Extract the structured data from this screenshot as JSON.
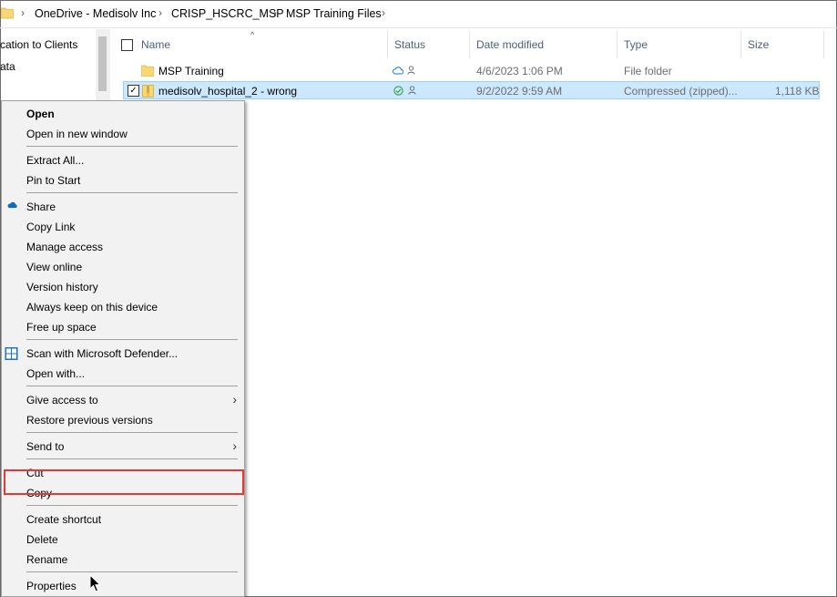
{
  "breadcrumb": [
    "OneDrive - Medisolv Inc",
    "CRISP_HSCRC_MSP",
    "MSP Training Files"
  ],
  "nav": {
    "items": [
      "cation to Clients",
      "ata"
    ]
  },
  "columns": {
    "name": "Name",
    "status": "Status",
    "date": "Date modified",
    "type": "Type",
    "size": "Size"
  },
  "files": [
    {
      "name": "MSP Training",
      "date": "4/6/2023 1:06 PM",
      "type": "File folder",
      "size": "",
      "status": "cloud"
    },
    {
      "name": "medisolv_hospital_2 - wrong",
      "date": "9/2/2022 9:59 AM",
      "type": "Compressed (zipped)...",
      "size": "1,118 KB",
      "status": "synced",
      "selected": true
    }
  ],
  "menu": {
    "open": "Open",
    "open_new_window": "Open in new window",
    "extract_all": "Extract All...",
    "pin_to_start": "Pin to Start",
    "share": "Share",
    "copy_link": "Copy Link",
    "manage_access": "Manage access",
    "view_online": "View online",
    "version_history": "Version history",
    "always_keep": "Always keep on this device",
    "free_up_space": "Free up space",
    "scan_defender": "Scan with Microsoft Defender...",
    "open_with": "Open with...",
    "give_access": "Give access to",
    "restore_versions": "Restore previous versions",
    "send_to": "Send to",
    "cut": "Cut",
    "copy": "Copy",
    "create_shortcut": "Create shortcut",
    "delete": "Delete",
    "rename": "Rename",
    "properties": "Properties"
  },
  "colors": {
    "selection": "#cce8ff",
    "highlight_border": "#e53935",
    "header_text": "#4c607a"
  }
}
